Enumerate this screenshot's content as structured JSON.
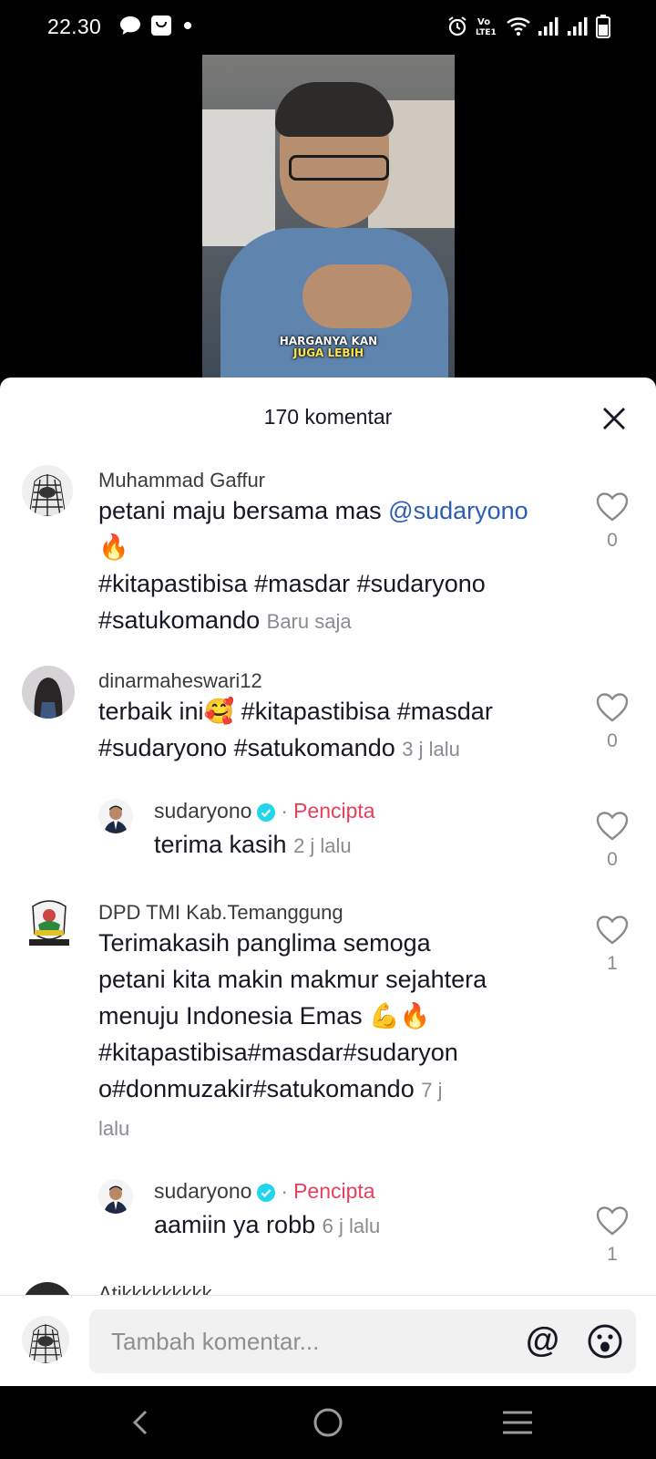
{
  "status_bar": {
    "time": "22.30",
    "icons": [
      "chat-bubble-icon",
      "shopping-bag-icon",
      "dot-icon",
      "alarm-icon",
      "volte-icon",
      "wifi-icon",
      "signal-icon",
      "signal-icon",
      "battery-icon"
    ]
  },
  "video": {
    "caption_line1": "HARGANYA KAN",
    "caption_line2": "JUGA LEBIH"
  },
  "sheet": {
    "title": "170 komentar"
  },
  "comments": [
    {
      "name": "Muhammad Gaffur",
      "text_before": "petani maju bersama mas ",
      "mention": "@sudaryono",
      "line2": "🔥",
      "line3": "#kitapastibisa #masdar #sudaryono",
      "line4": "#satukomando",
      "time": "Baru saja",
      "likes": "0"
    },
    {
      "name": "dinarmaheswari12",
      "line1": "terbaik ini🥰 #kitapastibisa #masdar",
      "line2": "#sudaryono #satukomando",
      "time": "3 j lalu",
      "likes": "0"
    },
    {
      "name": "sudaryono",
      "separator": "·",
      "badge": "Pencipta",
      "text": "terima kasih",
      "time": "2 j lalu",
      "likes": "0"
    },
    {
      "name": "DPD TMI Kab.Temanggung",
      "line1": "Terimakasih panglima semoga",
      "line2": "petani kita makin makmur sejahtera",
      "line3": "menuju Indonesia Emas 💪🔥",
      "line4": "#kitapastibisa#masdar#sudaryon",
      "line5": "o#donmuzakir#satukomando",
      "time_part1": "7 j",
      "time_part2": "lalu",
      "likes": "1"
    },
    {
      "name": "sudaryono",
      "separator": "·",
      "badge": "Pencipta",
      "text": "aamiin ya robb",
      "time": "6 j lalu",
      "likes": "1"
    }
  ],
  "next_comment_peek": "Atikkkkkkkkk",
  "input": {
    "placeholder": "Tambah komentar...",
    "at_symbol": "@"
  },
  "colors": {
    "mention": "#2b5db5",
    "creator_badge": "#e83e5c",
    "verified": "#20d5ec"
  }
}
